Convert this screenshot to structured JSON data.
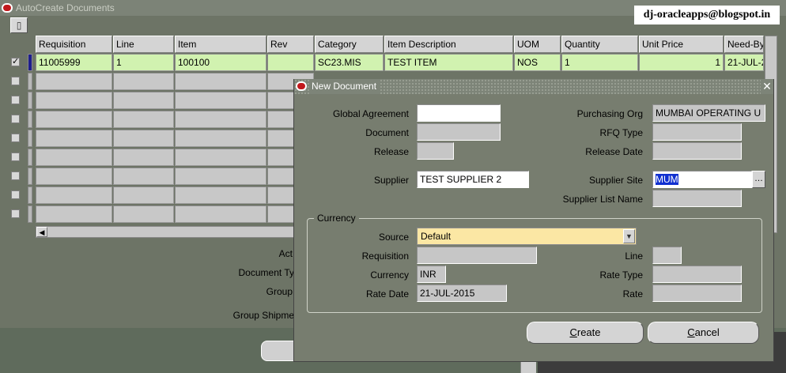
{
  "bg_window": {
    "title": "AutoCreate Documents",
    "columns": [
      "Requisition",
      "Line",
      "Item",
      "Rev",
      "Category",
      "Item Description",
      "UOM",
      "Quantity",
      "Unit Price",
      "Need-By"
    ],
    "first_row": [
      "11005999",
      "1",
      "100100",
      "",
      "SC23.MIS",
      "TEST ITEM",
      "NOS",
      "1",
      "1",
      "21-JUL-2"
    ],
    "labels": {
      "action": "Act",
      "document_type": "Document Ty",
      "group": "Group",
      "group_shipments": "Group Shipme"
    }
  },
  "brand": "dj-oracleapps@blogspot.in",
  "dialog": {
    "title": "New Document",
    "close_glyph": "✕",
    "labels": {
      "global_agreement": "Global Agreement",
      "document": "Document",
      "release": "Release",
      "supplier": "Supplier",
      "purchasing_org": "Purchasing Org",
      "rfq_type": "RFQ Type",
      "release_date": "Release Date",
      "supplier_site": "Supplier Site",
      "supplier_list_name": "Supplier List Name"
    },
    "values": {
      "global_agreement": "",
      "document": "",
      "release": "",
      "supplier": "TEST SUPPLIER 2",
      "purchasing_org": "MUMBAI OPERATING U",
      "rfq_type": "",
      "release_date": "",
      "supplier_site": "MUM",
      "supplier_list_name": ""
    },
    "lov_glyph": "…",
    "currency": {
      "group_title": "Currency",
      "labels": {
        "source": "Source",
        "requisition": "Requisition",
        "currency": "Currency",
        "rate_date": "Rate Date",
        "line": "Line",
        "rate_type": "Rate Type",
        "rate": "Rate"
      },
      "values": {
        "source": "Default",
        "requisition": "",
        "currency": "INR",
        "rate_date": "21-JUL-2015",
        "line": "",
        "rate_type": "",
        "rate": ""
      }
    },
    "buttons": {
      "create_first": "C",
      "create_rest": "reate",
      "cancel_first": "C",
      "cancel_rest": "ancel"
    }
  }
}
